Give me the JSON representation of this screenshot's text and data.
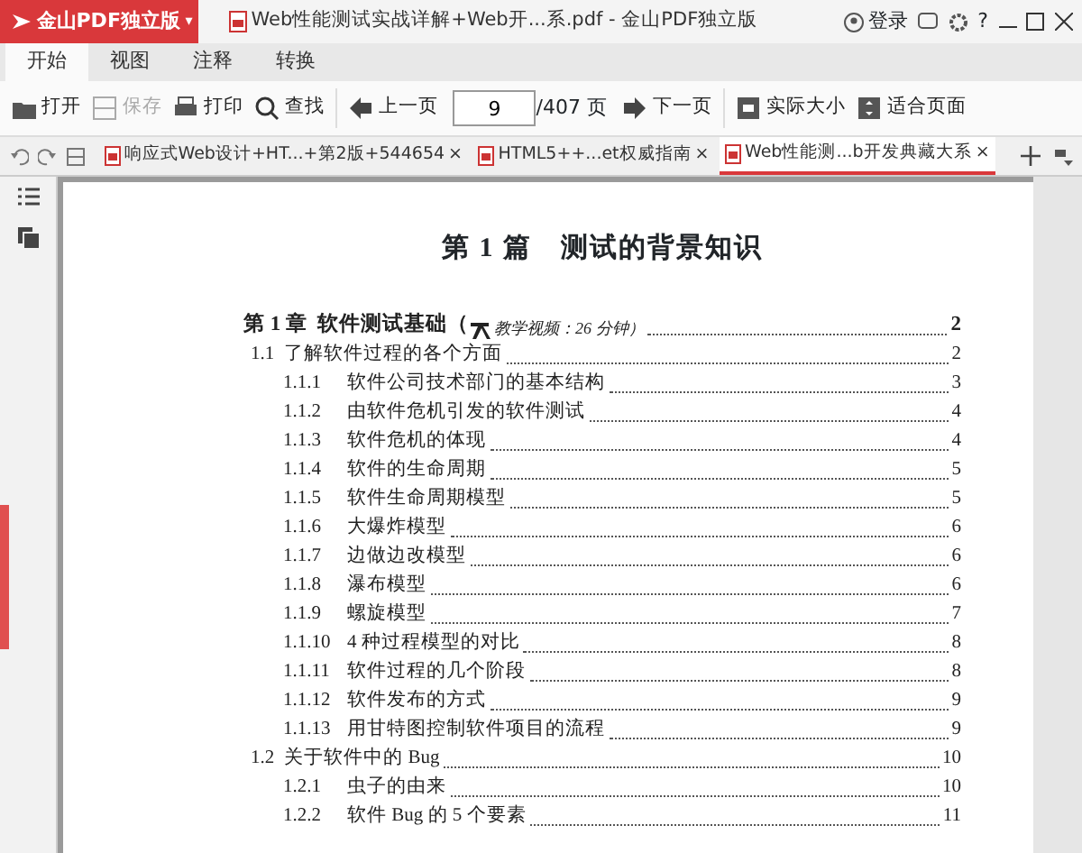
{
  "app_menu": {
    "label": "金山PDF独立版",
    "caret": "▾"
  },
  "window": {
    "title": "Web性能测试实战详解+Web开...系.pdf - 金山PDF独立版",
    "login": "登录",
    "help": "?"
  },
  "ribbon_tabs": [
    {
      "label": "开始",
      "selected": true
    },
    {
      "label": "视图",
      "selected": false
    },
    {
      "label": "注释",
      "selected": false
    },
    {
      "label": "转换",
      "selected": false
    }
  ],
  "toolbar": [
    {
      "kind": "button",
      "label": "打开",
      "disabled": false
    },
    {
      "kind": "button",
      "label": "保存",
      "disabled": true
    },
    {
      "kind": "button",
      "label": "打印",
      "disabled": false
    },
    {
      "kind": "button",
      "label": "查找",
      "disabled": false
    },
    {
      "kind": "separator"
    },
    {
      "kind": "button",
      "label": "上一页",
      "disabled": false
    },
    {
      "kind": "page",
      "value": "9",
      "total": "/407 页"
    },
    {
      "kind": "button",
      "label": "下一页",
      "disabled": false
    },
    {
      "kind": "separator"
    },
    {
      "kind": "button",
      "label": "实际大小",
      "disabled": false
    },
    {
      "kind": "button",
      "label": "适合页面",
      "disabled": false
    }
  ],
  "doc_tabs": [
    {
      "label": "响应式Web设计+HT...+第2版+544654",
      "close": "×",
      "selected": false
    },
    {
      "label": "HTML5++...et权威指南",
      "close": "×",
      "selected": false
    },
    {
      "label": "Web性能测...b开发典藏大系",
      "close": "×",
      "selected": true
    }
  ],
  "page": {
    "part_title": "第 1 篇　测试的背景知识",
    "toc": [
      {
        "number": "第 1 章",
        "title": "软件测试基础（",
        "note": "教学视频：26 分钟）",
        "page": "2",
        "children": [
          {
            "number": "1.1",
            "title": "了解软件过程的各个方面",
            "page": "2",
            "children": [
              {
                "number": "1.1.1",
                "title": "软件公司技术部门的基本结构",
                "page": "3"
              },
              {
                "number": "1.1.2",
                "title": "由软件危机引发的软件测试",
                "page": "4"
              },
              {
                "number": "1.1.3",
                "title": "软件危机的体现",
                "page": "4"
              },
              {
                "number": "1.1.4",
                "title": "软件的生命周期",
                "page": "5"
              },
              {
                "number": "1.1.5",
                "title": "软件生命周期模型",
                "page": "5"
              },
              {
                "number": "1.1.6",
                "title": "大爆炸模型",
                "page": "6"
              },
              {
                "number": "1.1.7",
                "title": "边做边改模型",
                "page": "6"
              },
              {
                "number": "1.1.8",
                "title": "瀑布模型",
                "page": "6"
              },
              {
                "number": "1.1.9",
                "title": "螺旋模型",
                "page": "7"
              },
              {
                "number": "1.1.10",
                "title": "4 种过程模型的对比",
                "page": "8"
              },
              {
                "number": "1.1.11",
                "title": "软件过程的几个阶段",
                "page": "8"
              },
              {
                "number": "1.1.12",
                "title": "软件发布的方式",
                "page": "9"
              },
              {
                "number": "1.1.13",
                "title": "用甘特图控制软件项目的流程",
                "page": "9"
              }
            ]
          },
          {
            "number": "1.2",
            "title": "关于软件中的 Bug",
            "page": "10",
            "children": [
              {
                "number": "1.2.1",
                "title": "虫子的由来",
                "page": "10"
              },
              {
                "number": "1.2.2",
                "title": "软件 Bug 的 5 个要素",
                "page": "11"
              }
            ]
          }
        ]
      }
    ]
  }
}
